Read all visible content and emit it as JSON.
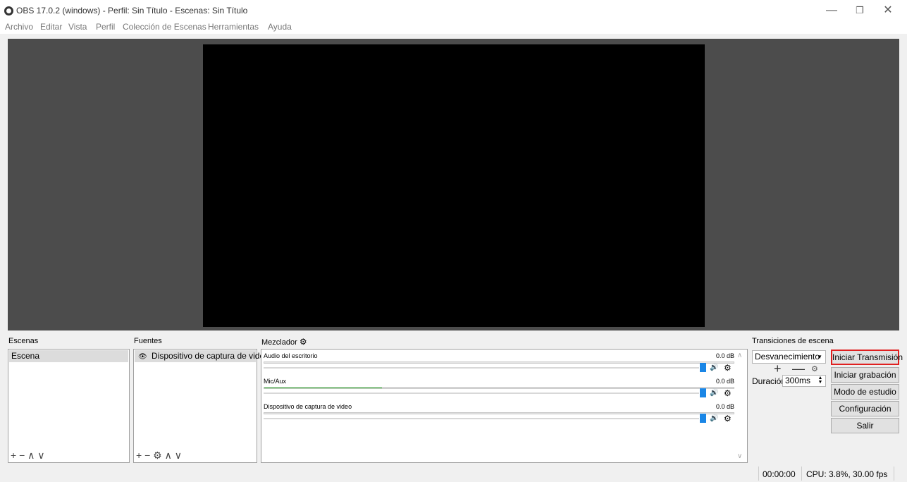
{
  "titlebar": {
    "title": "OBS 17.0.2 (windows) - Perfil: Sin Título - Escenas: Sin Título",
    "minimize": "—",
    "restore": "❐",
    "close": "✕"
  },
  "menu": [
    "Archivo",
    "Editar",
    "Vista",
    "Perfil",
    "Colección de Escenas",
    "Herramientas",
    "Ayuda"
  ],
  "scenes": {
    "title": "Escenas",
    "items": [
      "Escena"
    ],
    "toolbar": "+ −  ∧ ∨"
  },
  "sources": {
    "title": "Fuentes",
    "items": [
      "Dispositivo de captura de video"
    ],
    "toolbar": "+ − ⚙  ∧ ∨"
  },
  "mixer": {
    "title": "Mezclador",
    "tracks": [
      {
        "name": "Audio del escritorio",
        "db": "0.0 dB",
        "level": 0
      },
      {
        "name": "Mic/Aux",
        "db": "0.0 dB",
        "level": 0.25
      },
      {
        "name": "Dispositivo de captura de video",
        "db": "0.0 dB",
        "level": 0
      }
    ]
  },
  "transitions": {
    "title": "Transiciones de escena",
    "selected": "Desvanecimiento",
    "duration_label": "Duración",
    "duration_value": "300ms"
  },
  "controls": {
    "stream": "Iniciar Transmisión",
    "record": "Iniciar grabación",
    "studio": "Modo de estudio",
    "settings": "Configuración",
    "exit": "Salir"
  },
  "status": {
    "time": "00:00:00",
    "cpu": "CPU: 3.8%, 30.00 fps"
  },
  "colors": {
    "preview_bg": "#4c4c4c",
    "meter_green": "#35c233",
    "slider_blue": "#1a86e6",
    "highlight_red": "#e02020"
  }
}
